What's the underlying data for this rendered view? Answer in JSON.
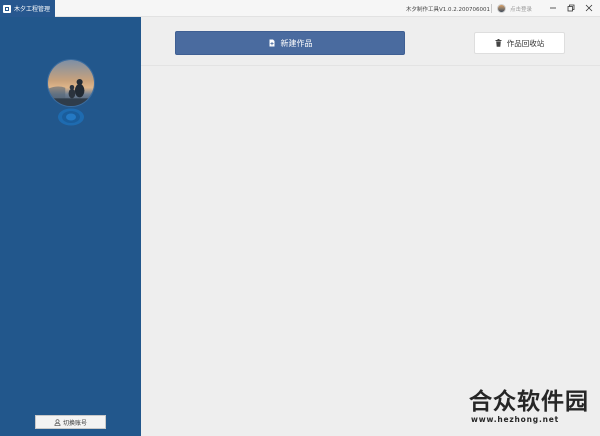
{
  "titlebar": {
    "app_tab_label": "木夕工程管理",
    "version_text": "木夕制作工具V1.0.2.200706001",
    "login_text": "点击登录",
    "minimize_icon": "minimize-icon",
    "maximize_icon": "restore-icon",
    "close_icon": "close-icon"
  },
  "sidebar": {
    "background": "#22578c",
    "switch_account_label": "切换账号"
  },
  "main": {
    "new_work_label": "新建作品",
    "new_work_color": "#4a6b9f",
    "recycle_bin_label": "作品回收站"
  },
  "watermark": {
    "title": "合众软件园",
    "url": "www.hezhong.net"
  }
}
